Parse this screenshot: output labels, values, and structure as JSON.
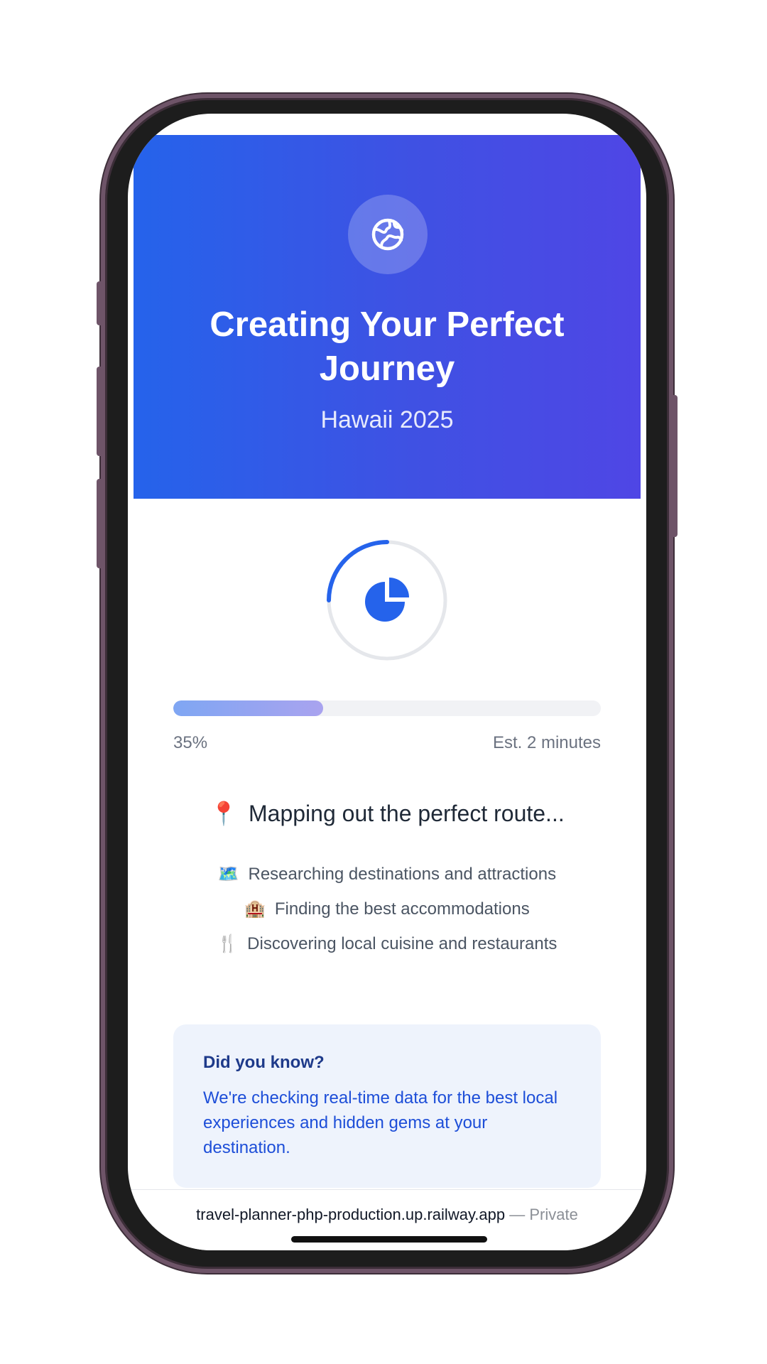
{
  "header": {
    "icon": "globe-icon",
    "title": "Creating Your Perfect Journey",
    "subtitle": "Hawaii 2025",
    "gradient_start": "#2563eb",
    "gradient_end": "#4f46e5"
  },
  "spinner": {
    "icon": "pie-chart-icon",
    "accent": "#2563eb"
  },
  "progress": {
    "value": 0.35,
    "percent_label": "35%",
    "eta_label": "Est. 2 minutes"
  },
  "status": {
    "current_emoji": "📍",
    "current_text": "Mapping out the perfect route...",
    "steps": [
      {
        "emoji": "🗺️",
        "text": "Researching destinations and attractions"
      },
      {
        "emoji": "🏨",
        "text": "Finding the best accommodations"
      },
      {
        "emoji": "🍴",
        "text": "Discovering local cuisine and restaurants"
      }
    ]
  },
  "fact": {
    "title": "Did you know?",
    "text": "We're checking real-time data for the best local experiences and hidden gems at your destination."
  },
  "browser": {
    "url": "travel-planner-php-production.up.railway.app",
    "privacy": " — Private"
  }
}
